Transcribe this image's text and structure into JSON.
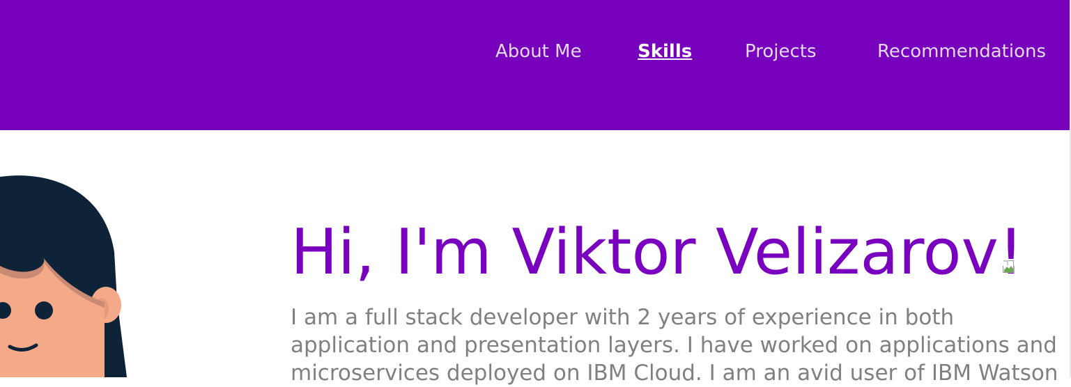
{
  "nav": {
    "items": [
      {
        "label": "About Me"
      },
      {
        "label": "Skills",
        "active": true
      },
      {
        "label": "Projects"
      },
      {
        "label": "Recommendations"
      }
    ]
  },
  "hero": {
    "title": "Hi, I'm Viktor Velizarov!",
    "intro": "I am a full stack developer with 2 years of experience in both application and presentation layers. I have worked on applications and microservices deployed on IBM Cloud. I am an avid user of IBM Watson"
  },
  "colors": {
    "header_bg": "#7700bd",
    "title": "#7a00bf",
    "body_text": "#808080",
    "avatar_hair": "#0f2338",
    "avatar_skin": "#f4aa88"
  },
  "icons": {
    "broken_image": "broken-image-icon",
    "avatar": "avatar-illustration"
  }
}
